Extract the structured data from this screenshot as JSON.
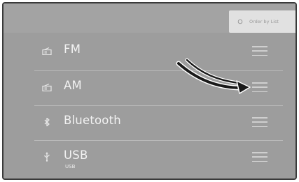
{
  "header": {
    "order_button_label": "Order by List",
    "order_button_icon": "sort-icon"
  },
  "sources": [
    {
      "label": "FM",
      "sublabel": "",
      "icon": "radio-icon"
    },
    {
      "label": "AM",
      "sublabel": "",
      "icon": "radio-icon"
    },
    {
      "label": "Bluetooth",
      "sublabel": "",
      "icon": "bluetooth-icon"
    },
    {
      "label": "USB",
      "sublabel": "USB",
      "icon": "usb-icon"
    }
  ],
  "colors": {
    "screen_bg": "#9d9d9d",
    "text": "#f2f2f2",
    "handle": "#cfcfcf",
    "arrow": "#1a1a1a"
  }
}
